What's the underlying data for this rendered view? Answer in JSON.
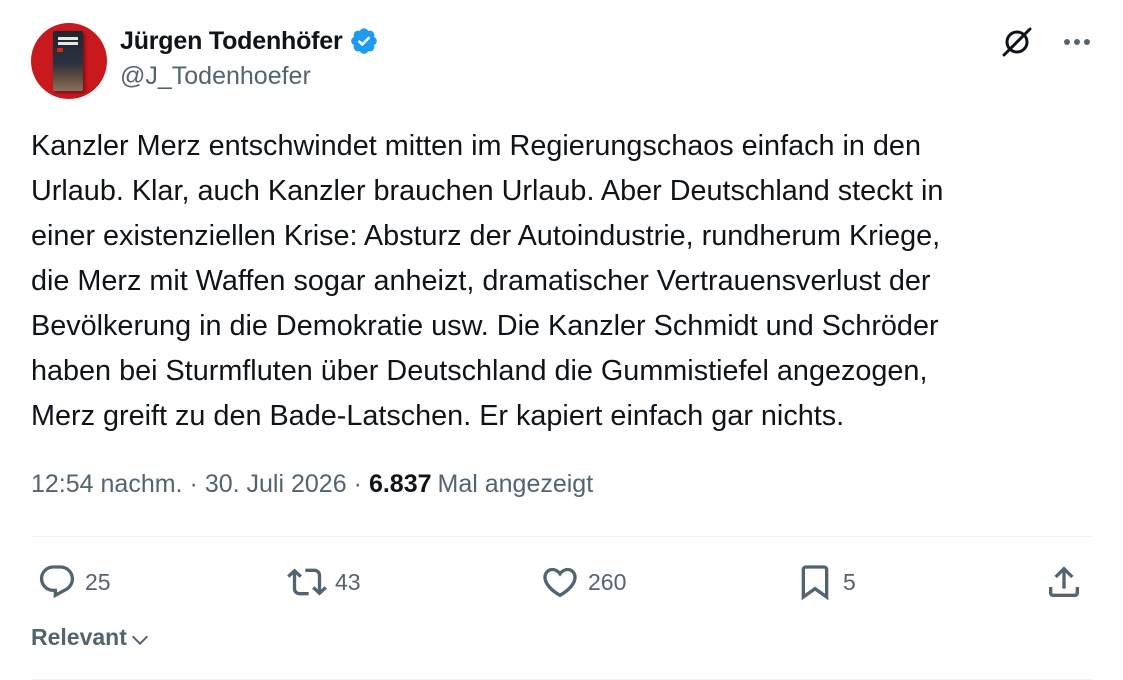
{
  "author": {
    "display_name": "Jürgen Todenhöfer",
    "handle": "@J_Todenhoefer",
    "verified": true,
    "avatar_icon": "book-cover-avatar"
  },
  "tweet": {
    "text": "Kanzler Merz entschwindet mitten im Regierungschaos einfach in den\nUrlaub. Klar, auch Kanzler brauchen Urlaub. Aber Deutschland steckt in\neiner existenziellen Krise: Absturz der Autoindustrie, rundherum Kriege,\ndie Merz mit Waffen sogar anheizt, dramatischer Vertrauensverlust der\nBevölkerung in die Demokratie usw. Die Kanzler Schmidt und Schröder\nhaben bei Sturmfluten über Deutschland die Gummistiefel angezogen,\nMerz greift zu den Bade-Latschen. Er kapiert einfach gar nichts.",
    "time": "12:54 nachm.",
    "separator": "·",
    "date": "30. Juli 2026",
    "views_count": "6.837",
    "views_label": "Mal angezeigt"
  },
  "actions": {
    "replies": "25",
    "retweets": "43",
    "likes": "260",
    "bookmarks": "5"
  },
  "sort": {
    "label": "Relevant"
  },
  "colors": {
    "text_primary": "#0f1419",
    "text_secondary": "#536471",
    "verified_blue": "#1d9bf0",
    "divider": "#eff3f4",
    "avatar_bg": "#c8191e"
  },
  "icons": {
    "verified": "verified-badge-icon",
    "grok": "grok-icon",
    "more": "more-horizontal-icon",
    "reply": "reply-icon",
    "retweet": "retweet-icon",
    "like": "heart-icon",
    "bookmark": "bookmark-icon",
    "share": "share-icon",
    "sort": "chevron-down-icon"
  }
}
